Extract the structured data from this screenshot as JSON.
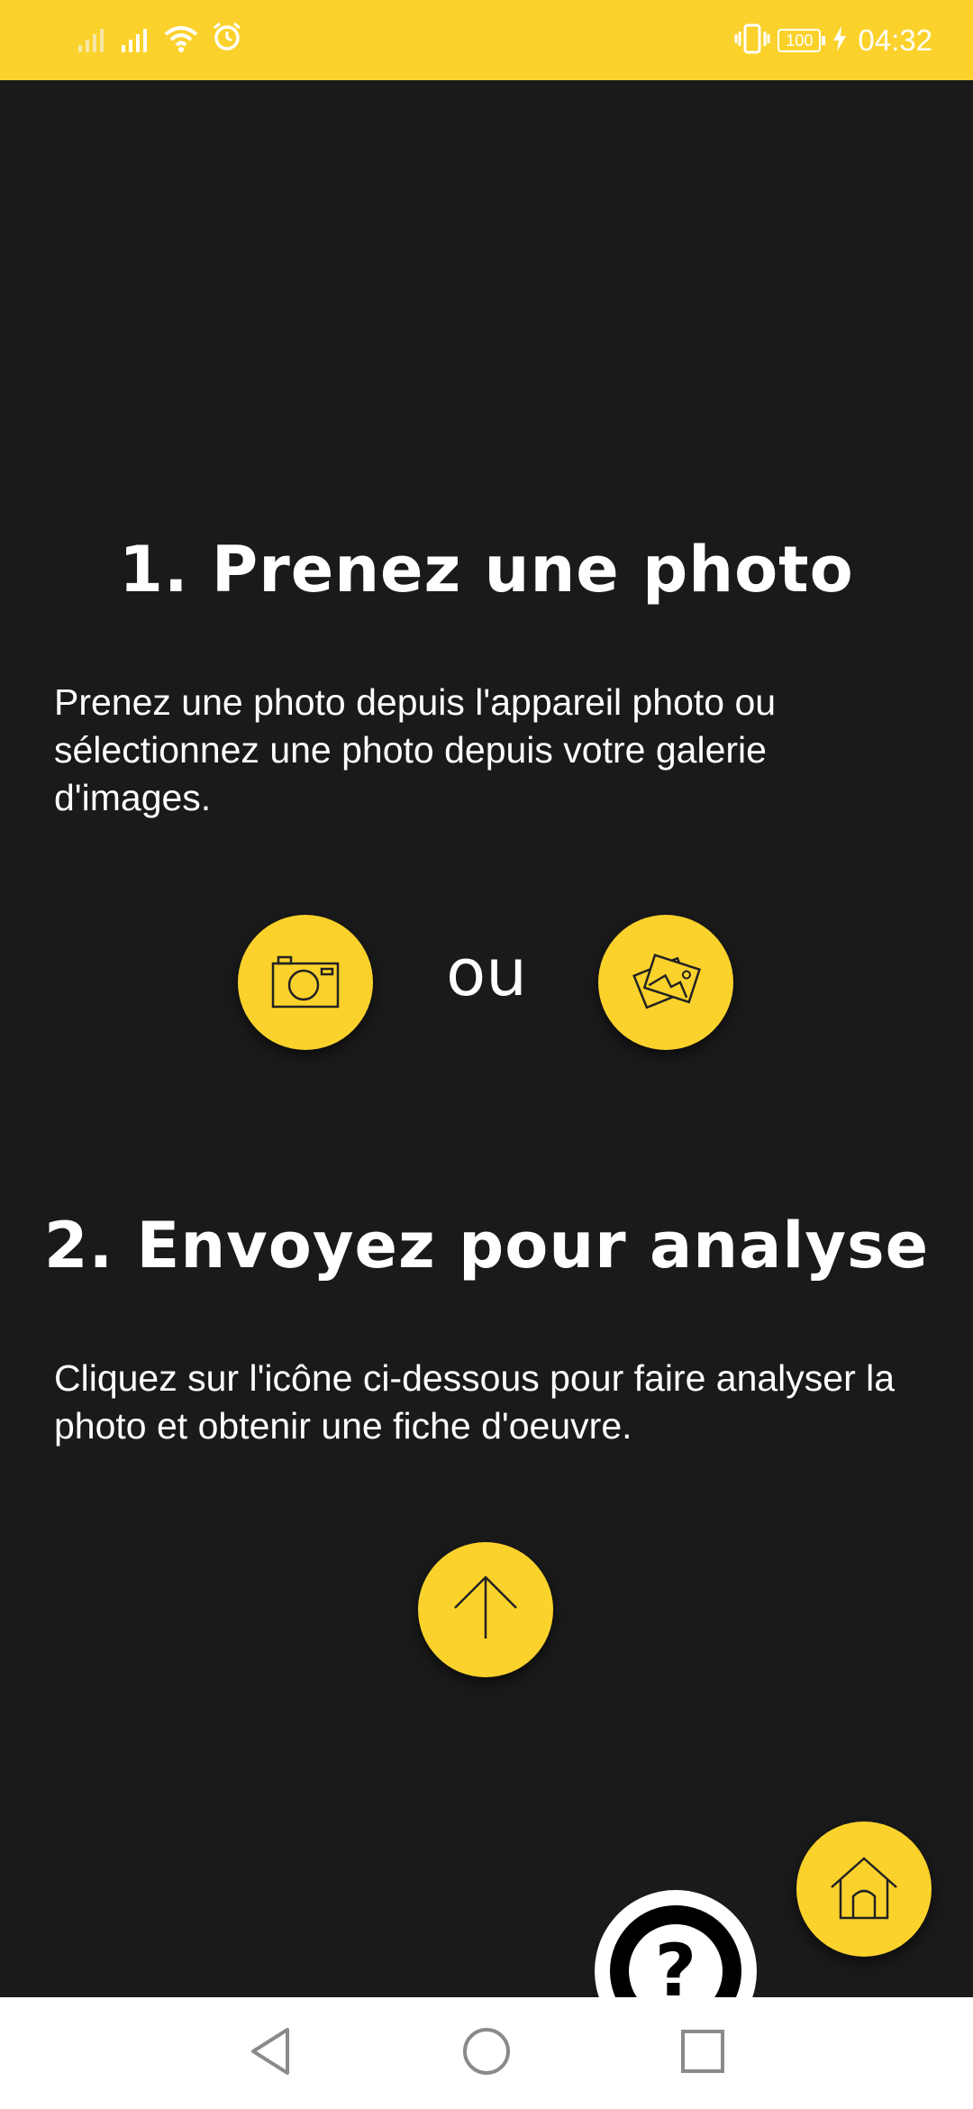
{
  "status_bar": {
    "time": "04:32",
    "battery_level": "100",
    "icons": [
      "signal-weak-icon",
      "signal-icon",
      "wifi-icon",
      "alarm-icon",
      "vibrate-icon",
      "battery-icon",
      "charging-icon"
    ]
  },
  "step1": {
    "title": "1. Prenez une photo",
    "description": "Prenez une photo depuis l'appareil photo ou sélectionnez une photo depuis votre galerie d'images.",
    "or_label": "ou",
    "camera_icon": "camera-icon",
    "gallery_icon": "gallery-icon"
  },
  "step2": {
    "title": "2. Envoyez pour analyse",
    "description": "Cliquez sur l'icône ci-dessous pour faire analyser la photo et obtenir une fiche d'oeuvre.",
    "upload_icon": "arrow-up-icon"
  },
  "fab": {
    "help_label": "?",
    "home_icon": "home-icon"
  },
  "navigation": {
    "icons": [
      "back-icon",
      "home-circle-icon",
      "recent-apps-icon"
    ]
  },
  "colors": {
    "accent": "#fbd22c",
    "background": "#1a1a1a",
    "text": "#ffffff",
    "icon_stroke": "#222222"
  }
}
